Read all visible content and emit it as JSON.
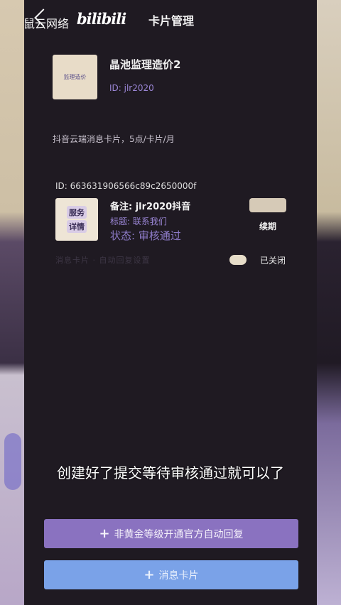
{
  "watermark": {
    "brand": "鼠云网络",
    "site": "bilibili"
  },
  "header": {
    "title": "卡片管理"
  },
  "account": {
    "name": "晶池监理造价2",
    "id": "ID: jlr2020",
    "avatar_text": "监理造价"
  },
  "description": "抖音云端消息卡片，5点/卡片/月",
  "card": {
    "id": "ID: 663631906566c89c2650000f",
    "thumb_tags": [
      "服务",
      "详情"
    ],
    "note": "备注: jlr2020抖音",
    "title": "标题: 联系我们",
    "status": "状态: 审核通过",
    "renew_label": "续期",
    "toggle_label": "已关闭",
    "faded_text": "消息卡片 · 自动回复设置"
  },
  "caption": "创建好了提交等待审核通过就可以了",
  "buttons": {
    "gold": {
      "icon": "+",
      "label": "非黄金等级开通官方自动回复"
    },
    "message": {
      "icon": "+",
      "label": "消息卡片"
    }
  },
  "colors": {
    "background": "#1f1a22",
    "accent_purple": "#8a72c0",
    "accent_blue": "#7aa2e8",
    "id_text": "#9b86d6"
  }
}
